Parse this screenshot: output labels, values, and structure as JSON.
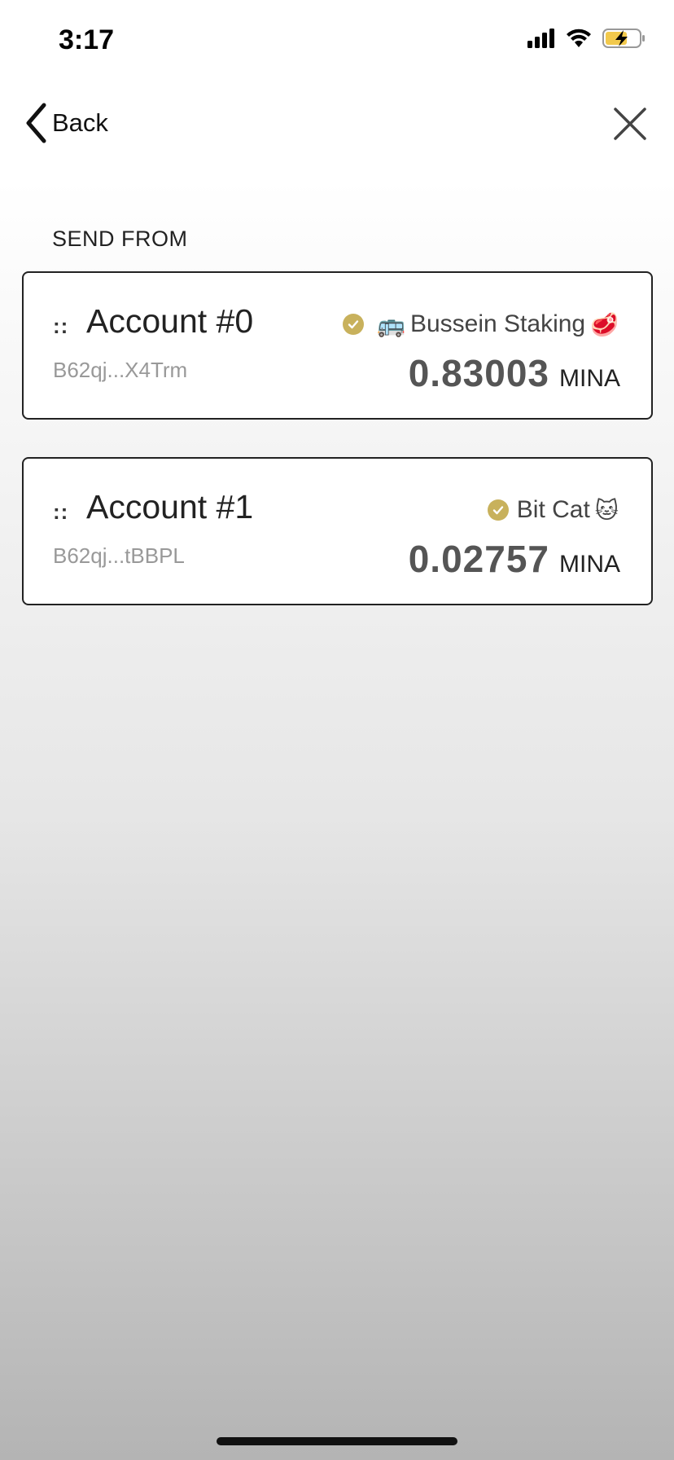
{
  "status_bar": {
    "time": "3:17"
  },
  "nav": {
    "back_label": "Back"
  },
  "section": {
    "label": "SEND FROM"
  },
  "accounts": [
    {
      "handle": "::",
      "name": "Account #0",
      "address": "B62qj...X4Trm",
      "delegate": "Bussein Staking",
      "delegate_emoji_before": "🚌",
      "delegate_emoji_after": "🥩",
      "balance": "0.83003",
      "unit": "MINA"
    },
    {
      "handle": "::",
      "name": "Account #1",
      "address": "B62qj...tBBPL",
      "delegate": "Bit Cat",
      "delegate_emoji_before": "",
      "delegate_emoji_after": "🐱",
      "balance": "0.02757",
      "unit": "MINA"
    }
  ],
  "colors": {
    "verified": "#c8b15c",
    "card_border": "#222222",
    "address": "#999999"
  }
}
